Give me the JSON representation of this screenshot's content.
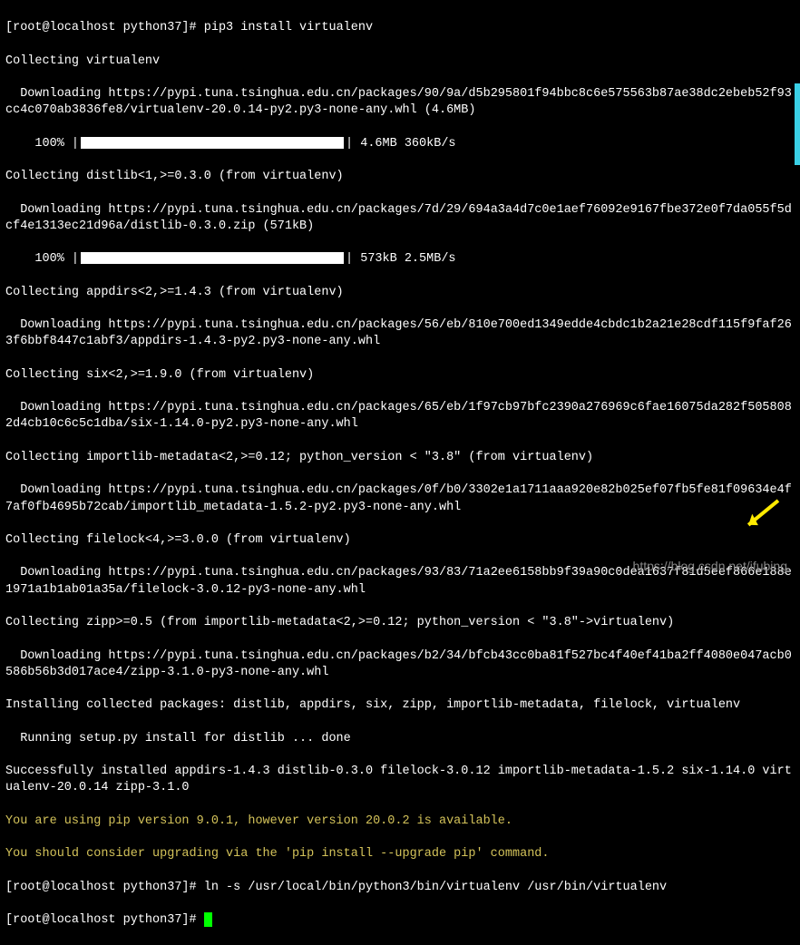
{
  "prompt1_user": "[root@localhost python37]#",
  "prompt1_cmd": " pip3 install virtualenv",
  "l2": "Collecting virtualenv",
  "l3": "  Downloading https://pypi.tuna.tsinghua.edu.cn/packages/90/9a/d5b295801f94bbc8c6e575563b87ae38dc2ebeb52f93cc4c070ab3836fe8/virtualenv-20.0.14-py2.py3-none-any.whl (4.6MB)",
  "l4_pct": "    100% |",
  "l4_stats": "| 4.6MB 360kB/s",
  "l5": "Collecting distlib<1,>=0.3.0 (from virtualenv)",
  "l6": "  Downloading https://pypi.tuna.tsinghua.edu.cn/packages/7d/29/694a3a4d7c0e1aef76092e9167fbe372e0f7da055f5dcf4e1313ec21d96a/distlib-0.3.0.zip (571kB)",
  "l7_pct": "    100% |",
  "l7_stats": "| 573kB 2.5MB/s",
  "l8": "Collecting appdirs<2,>=1.4.3 (from virtualenv)",
  "l9": "  Downloading https://pypi.tuna.tsinghua.edu.cn/packages/56/eb/810e700ed1349edde4cbdc1b2a21e28cdf115f9faf263f6bbf8447c1abf3/appdirs-1.4.3-py2.py3-none-any.whl",
  "l10": "Collecting six<2,>=1.9.0 (from virtualenv)",
  "l11": "  Downloading https://pypi.tuna.tsinghua.edu.cn/packages/65/eb/1f97cb97bfc2390a276969c6fae16075da282f5058082d4cb10c6c5c1dba/six-1.14.0-py2.py3-none-any.whl",
  "l12": "Collecting importlib-metadata<2,>=0.12; python_version < \"3.8\" (from virtualenv)",
  "l13": "  Downloading https://pypi.tuna.tsinghua.edu.cn/packages/0f/b0/3302e1a1711aaa920e82b025ef07fb5fe81f09634e4f7af0fb4695b72cab/importlib_metadata-1.5.2-py2.py3-none-any.whl",
  "l14": "Collecting filelock<4,>=3.0.0 (from virtualenv)",
  "l15": "  Downloading https://pypi.tuna.tsinghua.edu.cn/packages/93/83/71a2ee6158bb9f39a90c0dea1637f81d5eef866e188e1971a1b1ab01a35a/filelock-3.0.12-py3-none-any.whl",
  "l16": "Collecting zipp>=0.5 (from importlib-metadata<2,>=0.12; python_version < \"3.8\"->virtualenv)",
  "l17": "  Downloading https://pypi.tuna.tsinghua.edu.cn/packages/b2/34/bfcb43cc0ba81f527bc4f40ef41ba2ff4080e047acb0586b56b3d017ace4/zipp-3.1.0-py3-none-any.whl",
  "l18": "Installing collected packages: distlib, appdirs, six, zipp, importlib-metadata, filelock, virtualenv",
  "l19": "  Running setup.py install for distlib ... done",
  "l20": "Successfully installed appdirs-1.4.3 distlib-0.3.0 filelock-3.0.12 importlib-metadata-1.5.2 six-1.14.0 virtualenv-20.0.14 zipp-3.1.0",
  "l21": "You are using pip version 9.0.1, however version 20.0.2 is available.",
  "l22": "You should consider upgrading via the 'pip install --upgrade pip' command.",
  "prompt2_user": "[root@localhost python37]#",
  "prompt2_cmd": " ln -s /usr/local/bin/python3/bin/virtualenv /usr/bin/virtualenv",
  "prompt3_user": "[root@localhost python37]#",
  "prompt3_cmd": " ",
  "watermark": "https://blog.csdn.net/ifubing"
}
